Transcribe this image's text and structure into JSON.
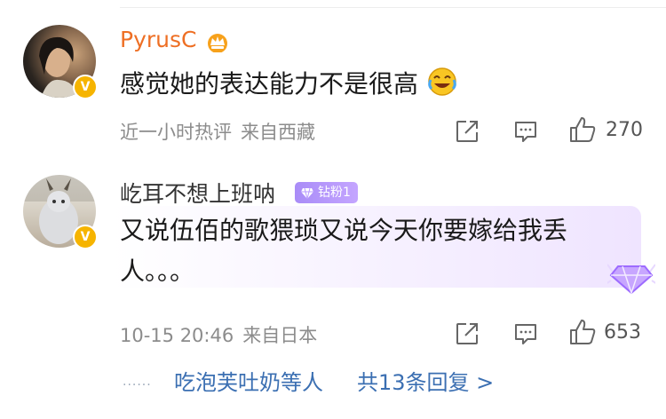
{
  "comments": [
    {
      "username": "PyrusC",
      "text": "感觉她的表达能力不是很高",
      "time": "近一小时热评",
      "source": "来自西藏",
      "likes": "270"
    },
    {
      "username": "屹耳不想上班呐",
      "fan_badge": "钻粉1",
      "text_line1": "又说伍佰的歌猥琐又说今天你要嫁给我丢",
      "text_line2": "人。。。",
      "time": "10-15 20:46",
      "source": "来自日本",
      "likes": "653",
      "reply_users": "吃泡芙吐奶等人",
      "reply_count": "共13条回复 >"
    }
  ],
  "colors": {
    "username_vip": "#ee6f24",
    "username": "#333333",
    "link": "#3b6fb2",
    "verified_badge": "#f6b400",
    "fan_badge": "#a98cf7"
  },
  "icons": [
    "crown-icon",
    "laugh-cry-emoji-icon",
    "verified-badge-icon",
    "gem-icon",
    "share-icon",
    "comment-icon",
    "like-icon"
  ]
}
